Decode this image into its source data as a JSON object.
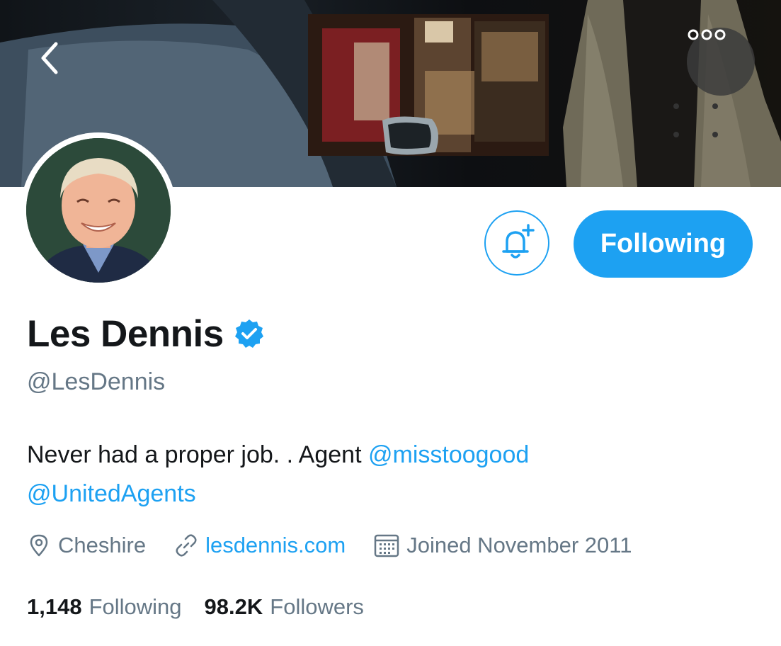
{
  "header": {
    "back_icon": "chevron-left-icon",
    "more_icon": "more-horizontal-icon"
  },
  "profile": {
    "display_name": "Les Dennis",
    "verified": true,
    "handle": "@LesDennis",
    "bio_text": "Never had a proper job. . Agent ",
    "bio_mentions": [
      "@misstoogood",
      "@UnitedAgents"
    ],
    "location": "Cheshire",
    "website": "lesdennis.com",
    "joined": "Joined November 2011"
  },
  "actions": {
    "notify_icon": "bell-plus-icon",
    "following_label": "Following"
  },
  "stats": {
    "following_count": "1,148",
    "following_label": "Following",
    "followers_count": "98.2K",
    "followers_label": "Followers"
  },
  "colors": {
    "accent": "#1da1f2",
    "secondary_text": "#657786",
    "primary_text": "#14171a"
  }
}
